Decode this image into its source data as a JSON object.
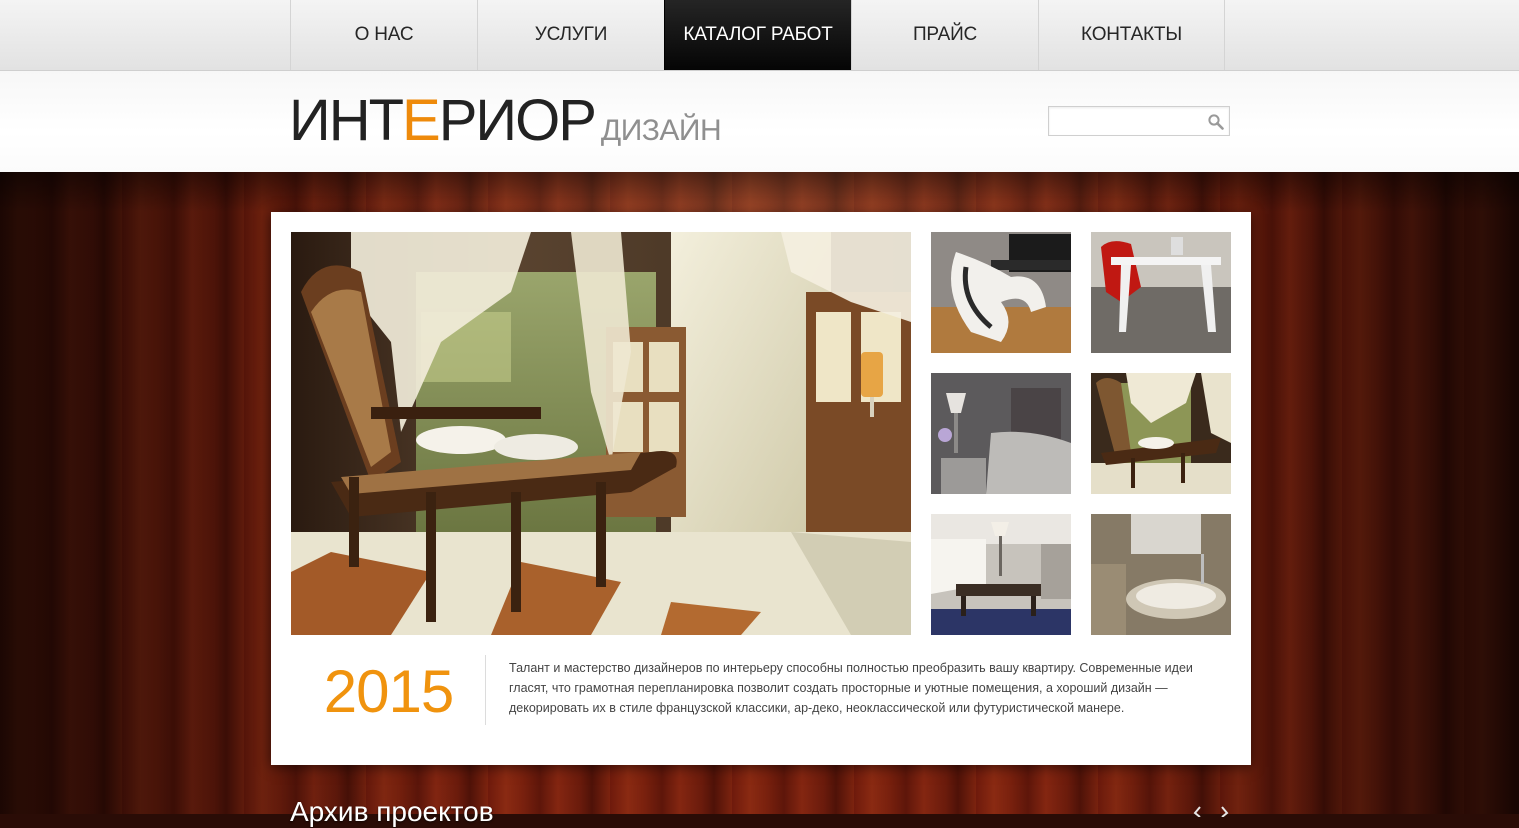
{
  "nav": {
    "items": [
      {
        "label": "О НАС",
        "active": false
      },
      {
        "label": "УСЛУГИ",
        "active": false
      },
      {
        "label": "КАТАЛОГ РАБОТ",
        "active": true
      },
      {
        "label": "ПРАЙС",
        "active": false
      },
      {
        "label": "КОНТАКТЫ",
        "active": false
      }
    ]
  },
  "header": {
    "logo_part1": "ИНТ",
    "logo_accent": "Е",
    "logo_part2": "РИОР",
    "logo_sub": "ДИЗАЙН",
    "search_placeholder": "",
    "search_icon": "magnifier-icon"
  },
  "gallery": {
    "hero": "chaise-lounge-by-window-photo",
    "thumbnails": [
      "white-lounge-chair-photo",
      "red-chair-white-table-photo",
      "bedroom-lamp-photo",
      "chaise-lounge-photo",
      "living-room-sofa-photo",
      "marble-bathroom-photo"
    ]
  },
  "intro": {
    "year": "2015",
    "text": "Талант и мастерство дизайнеров по интерьеру способны полностью преобразить вашу квартиру. Современные идеи гласят, что грамотная перепланировка позволит создать просторные и уютные помещения, а хороший дизайн — декорировать их в стиле французской классики, ар-деко, неоклассической или футуристической манере."
  },
  "archive": {
    "title": "Архив проектов"
  },
  "colors": {
    "accent": "#ee8a0b",
    "nav_active": "#111111",
    "wood": "#6a1b0c"
  }
}
